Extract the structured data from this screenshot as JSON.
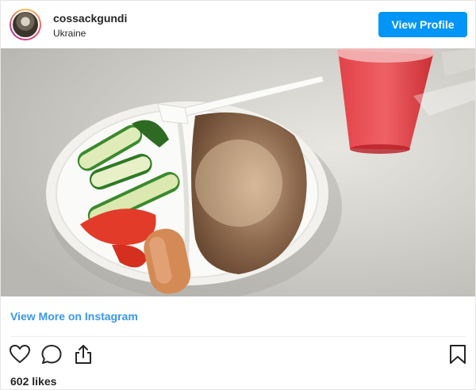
{
  "header": {
    "username": "cossackgundi",
    "location": "Ukraine",
    "view_profile_label": "View Profile"
  },
  "post": {
    "image_icon": "food-photo"
  },
  "footer": {
    "view_more_label": "View More on Instagram",
    "likes_text": "602 likes",
    "icons": [
      "heart-icon",
      "comment-icon",
      "share-icon",
      "bookmark-icon"
    ]
  },
  "colors": {
    "accent": "#0095f6",
    "link": "#3897f0",
    "text": "#262626"
  }
}
